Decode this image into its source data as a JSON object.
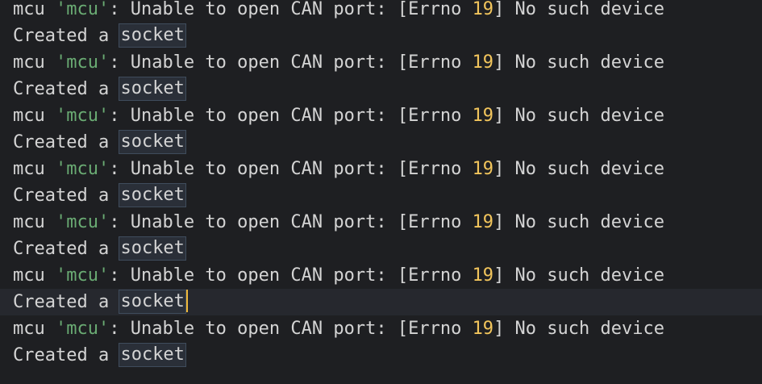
{
  "console": {
    "error_line": {
      "prefix": "mcu ",
      "module_quoted": "'mcu'",
      "msg_a": ": Unable to open CAN port: [Errno ",
      "errno": "19",
      "msg_b": "] No such device"
    },
    "created_line": {
      "prefix": "Created a ",
      "word": "socket"
    },
    "line_order": [
      "created",
      "error",
      "created",
      "error",
      "created",
      "error",
      "created",
      "error",
      "created",
      "error",
      "created",
      "error",
      "created",
      "error",
      "created"
    ],
    "current_line_index": 12
  },
  "colors": {
    "background": "#1e1f22",
    "text": "#d4d4d4",
    "string": "#6aab73",
    "number": "#f2c55c",
    "caret": "#f0b93a",
    "highlight_border": "#3f4c5c",
    "current_line_bg": "#26282e"
  }
}
